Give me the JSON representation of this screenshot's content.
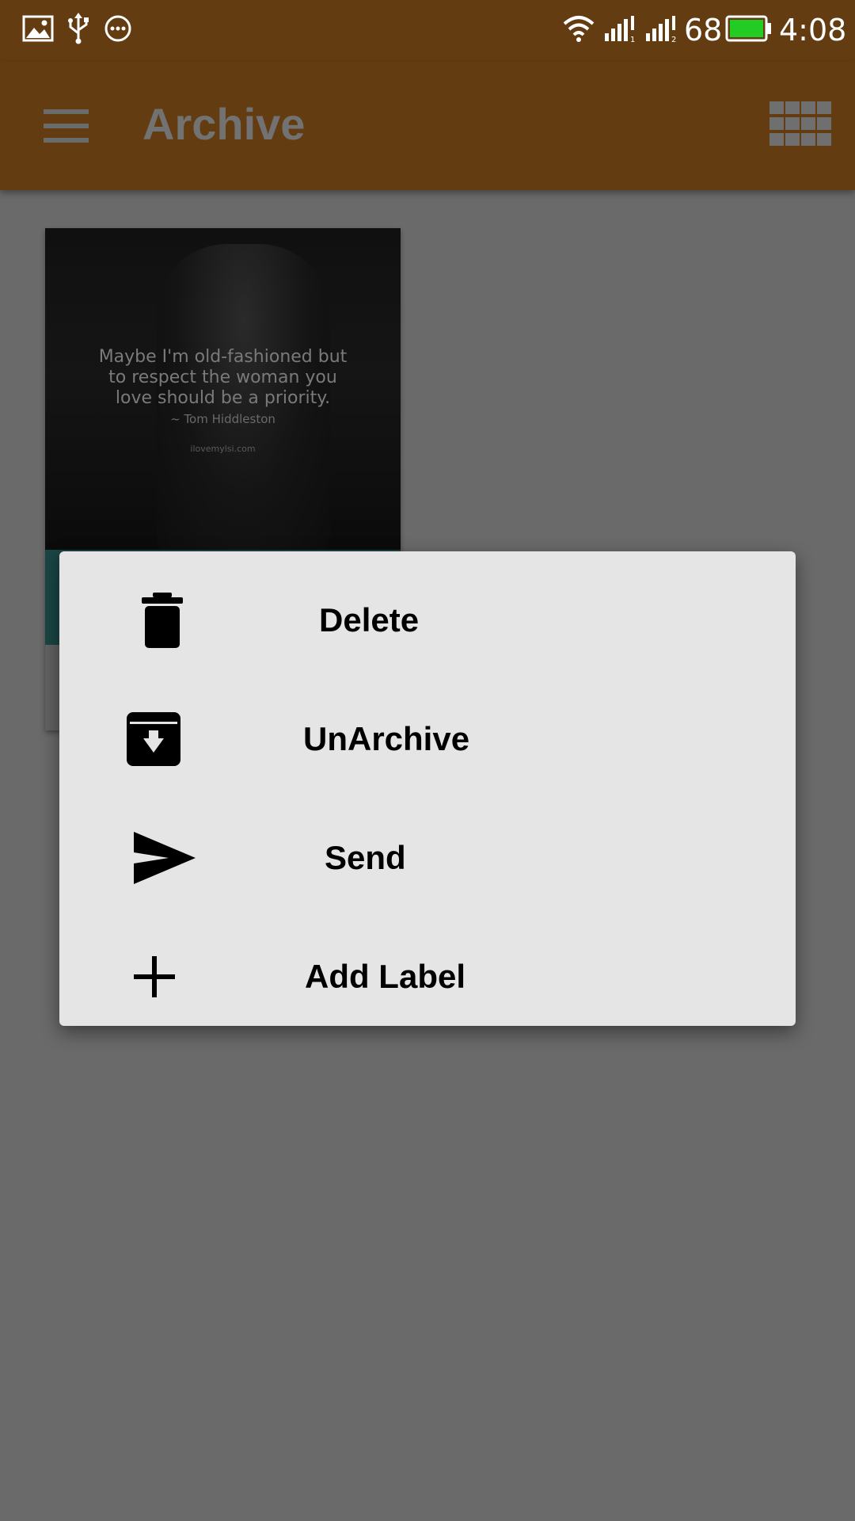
{
  "status_bar": {
    "battery_level": "68",
    "time": "4:08",
    "battery_color": "#22cc22",
    "icons": [
      "image-icon",
      "usb-icon",
      "more-icon",
      "wifi-icon",
      "signal-1-icon",
      "signal-2-icon",
      "battery-icon"
    ]
  },
  "app_bar": {
    "title": "Archive",
    "background": "#643c12",
    "menu_icon": "hamburger-menu-icon",
    "view_icon": "grid-view-icon"
  },
  "note": {
    "quote": "Maybe I'm old-fashioned but to respect the woman you love should be a priority.",
    "quote_lines": [
      "Maybe I'm old-fashioned but",
      "to respect the woman you",
      "love should be a priority."
    ],
    "author": "~ Tom Hiddleston",
    "source": "ilovemylsi.com",
    "band_color": "#1a4544"
  },
  "context_menu": {
    "items": [
      {
        "label": "Delete",
        "icon": "trash-icon"
      },
      {
        "label": "UnArchive",
        "icon": "unarchive-icon"
      },
      {
        "label": "Send",
        "icon": "send-icon"
      },
      {
        "label": "Add Label",
        "icon": "plus-icon"
      }
    ]
  }
}
